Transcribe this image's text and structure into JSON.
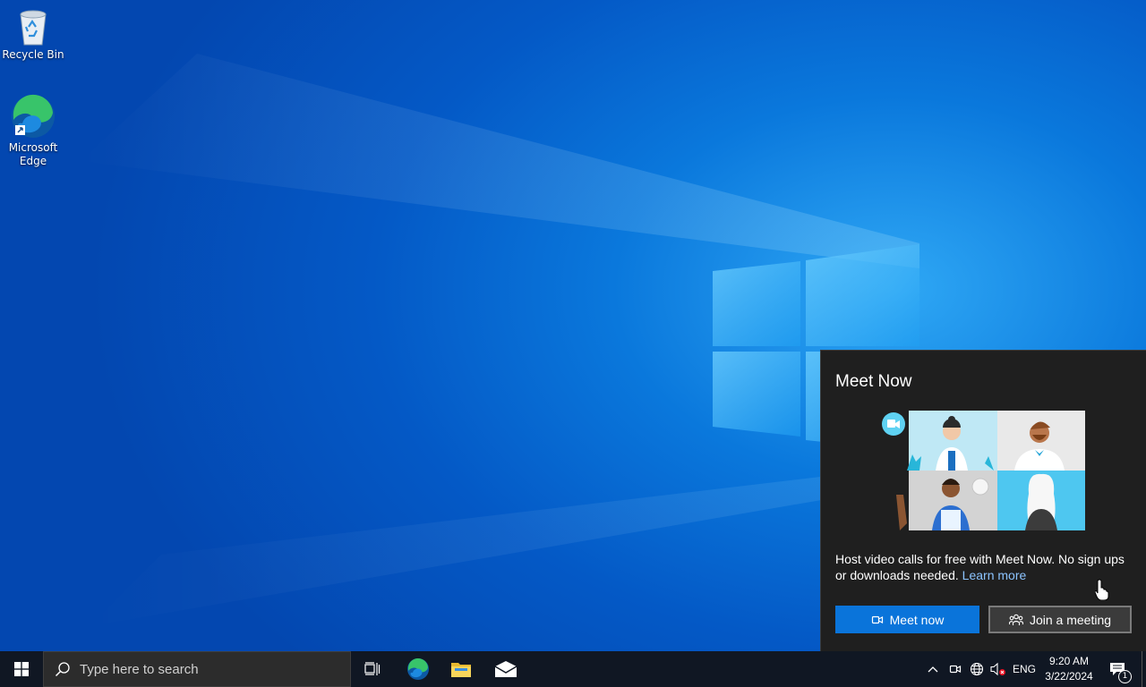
{
  "desktop": {
    "icons": [
      {
        "label": "Recycle Bin",
        "icon": "recycle-bin-icon"
      },
      {
        "label": "Microsoft\nEdge",
        "icon": "edge-icon"
      }
    ]
  },
  "flyout": {
    "title": "Meet Now",
    "description": "Host video calls for free with Meet Now. No sign ups or downloads needed.",
    "learn_more": "Learn more",
    "primary_button": "Meet now",
    "secondary_button": "Join a meeting"
  },
  "taskbar": {
    "search_placeholder": "Type here to search",
    "pinned": [
      "task-view-icon",
      "edge-icon",
      "file-explorer-icon",
      "mail-icon"
    ],
    "tray": {
      "language": "ENG",
      "time": "9:20 AM",
      "date": "3/22/2024",
      "notification_count": "1"
    }
  },
  "colors": {
    "accent": "#0a74da",
    "flyout_bg": "#1f1f1f",
    "taskbar_bg": "#101723",
    "link": "#8cc4ff"
  }
}
